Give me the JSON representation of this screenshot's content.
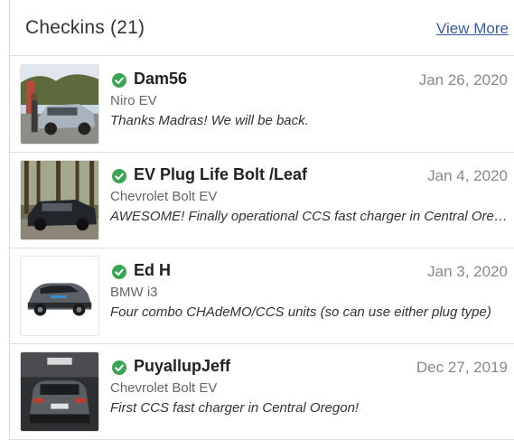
{
  "header": {
    "title": "Checkins (21)",
    "view_more": "View More"
  },
  "colors": {
    "check_green": "#3aa655",
    "link_blue": "#3a5ba8"
  },
  "checkins": [
    {
      "user": "Dam56",
      "date": "Jan 26, 2020",
      "vehicle": "Niro EV",
      "comment": "Thanks Madras! We will be back.",
      "icon": "verified-check-icon"
    },
    {
      "user": "EV Plug Life Bolt /Leaf",
      "date": "Jan 4, 2020",
      "vehicle": "Chevrolet Bolt EV",
      "comment": "AWESOME! Finally operational CCS fast charger in Central Oregon!",
      "icon": "verified-check-icon"
    },
    {
      "user": "Ed H",
      "date": "Jan 3, 2020",
      "vehicle": "BMW i3",
      "comment": "Four combo CHAdeMO/CCS units (so can use either plug type)",
      "icon": "verified-check-icon"
    },
    {
      "user": "PuyallupJeff",
      "date": "Dec 27, 2019",
      "vehicle": "Chevrolet Bolt EV",
      "comment": "First CCS fast charger in Central Oregon!",
      "icon": "verified-check-icon"
    }
  ]
}
